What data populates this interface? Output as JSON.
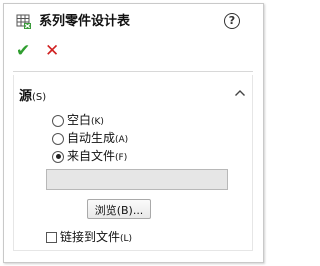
{
  "panel": {
    "title": "系列零件设计表",
    "help_symbol": "?",
    "ok_symbol": "✔",
    "cancel_symbol": "✕"
  },
  "source_group": {
    "title": "源",
    "mnemonic": "(S)",
    "options": [
      {
        "label": "空白",
        "mnemonic": "(K)",
        "checked": false
      },
      {
        "label": "自动生成",
        "mnemonic": "(A)",
        "checked": false
      },
      {
        "label": "来自文件",
        "mnemonic": "(F)",
        "checked": true
      }
    ],
    "file_path_value": "",
    "browse_label": "浏览",
    "browse_mnemonic": "(B)...",
    "link_label": "链接到文件",
    "link_mnemonic": "(L)",
    "link_checked": false
  },
  "colors": {
    "ok": "#2f9e2f",
    "cancel": "#d02020",
    "table_icon_green": "#3a9a3a"
  }
}
